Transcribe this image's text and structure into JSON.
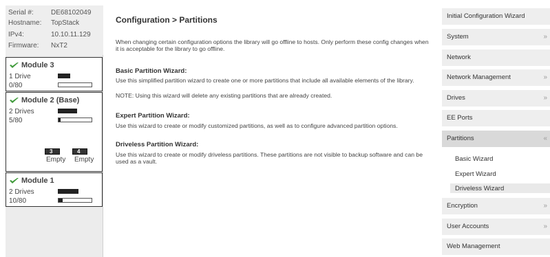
{
  "system_info": {
    "serial": {
      "label": "Serial #:",
      "value": "DE68102049"
    },
    "hostname": {
      "label": "Hostname:",
      "value": "TopStack"
    },
    "ipv4": {
      "label": "IPv4:",
      "value": "10.10.11.129"
    },
    "firmware": {
      "label": "Firmware:",
      "value": "NxT2"
    }
  },
  "modules": [
    {
      "title": "Module 3",
      "drives": "1 Drive",
      "slots": "0/80",
      "drive_fill": 0.35,
      "slot_fill": 0.0
    },
    {
      "title": "Module 2 (Base)",
      "drives": "2 Drives",
      "slots": "5/80",
      "drive_fill": 0.55,
      "slot_fill": 0.06,
      "magazines": [
        {
          "number": "3",
          "label": "Empty"
        },
        {
          "number": "4",
          "label": "Empty"
        }
      ]
    },
    {
      "title": "Module 1",
      "drives": "2 Drives",
      "slots": "10/80",
      "drive_fill": 0.6,
      "slot_fill": 0.12
    }
  ],
  "main": {
    "title": "Configuration > Partitions",
    "intro": "When changing certain configuration options the library will go offline to hosts. Only perform these config changes when it is acceptable for the library to go offline.",
    "sections": [
      {
        "heading": "Basic Partition Wizard:",
        "text": "Use this simplified partition wizard to create one or more partitions that include all available elements of the library.",
        "note": "NOTE: Using this wizard will delete any existing partitions that are already created."
      },
      {
        "heading": "Expert Partition Wizard:",
        "text": "Use this wizard to create or modify customized partitions, as well as to configure advanced partition options."
      },
      {
        "heading": "Driveless Partition Wizard:",
        "text": "Use this wizard to create or modify driveless partitions. These partitions are not visible to backup software and can be used as a vault."
      }
    ]
  },
  "nav": {
    "items": [
      {
        "label": "Initial Configuration Wizard",
        "chevron": ""
      },
      {
        "label": "System",
        "chevron": "»"
      },
      {
        "label": "Network",
        "chevron": ""
      },
      {
        "label": "Network Management",
        "chevron": "»"
      },
      {
        "label": "Drives",
        "chevron": "»"
      },
      {
        "label": "EE Ports",
        "chevron": ""
      },
      {
        "label": "Partitions",
        "chevron": "«"
      },
      {
        "label": "Encryption",
        "chevron": "»"
      },
      {
        "label": "User Accounts",
        "chevron": "»"
      },
      {
        "label": "Web Management",
        "chevron": ""
      }
    ],
    "partitions_sub": [
      "Basic Wizard",
      "Expert Wizard",
      "Driveless Wizard"
    ]
  },
  "colors": {
    "check": "#3f9a3a",
    "accent_nav_active": "#d9d9d9"
  }
}
